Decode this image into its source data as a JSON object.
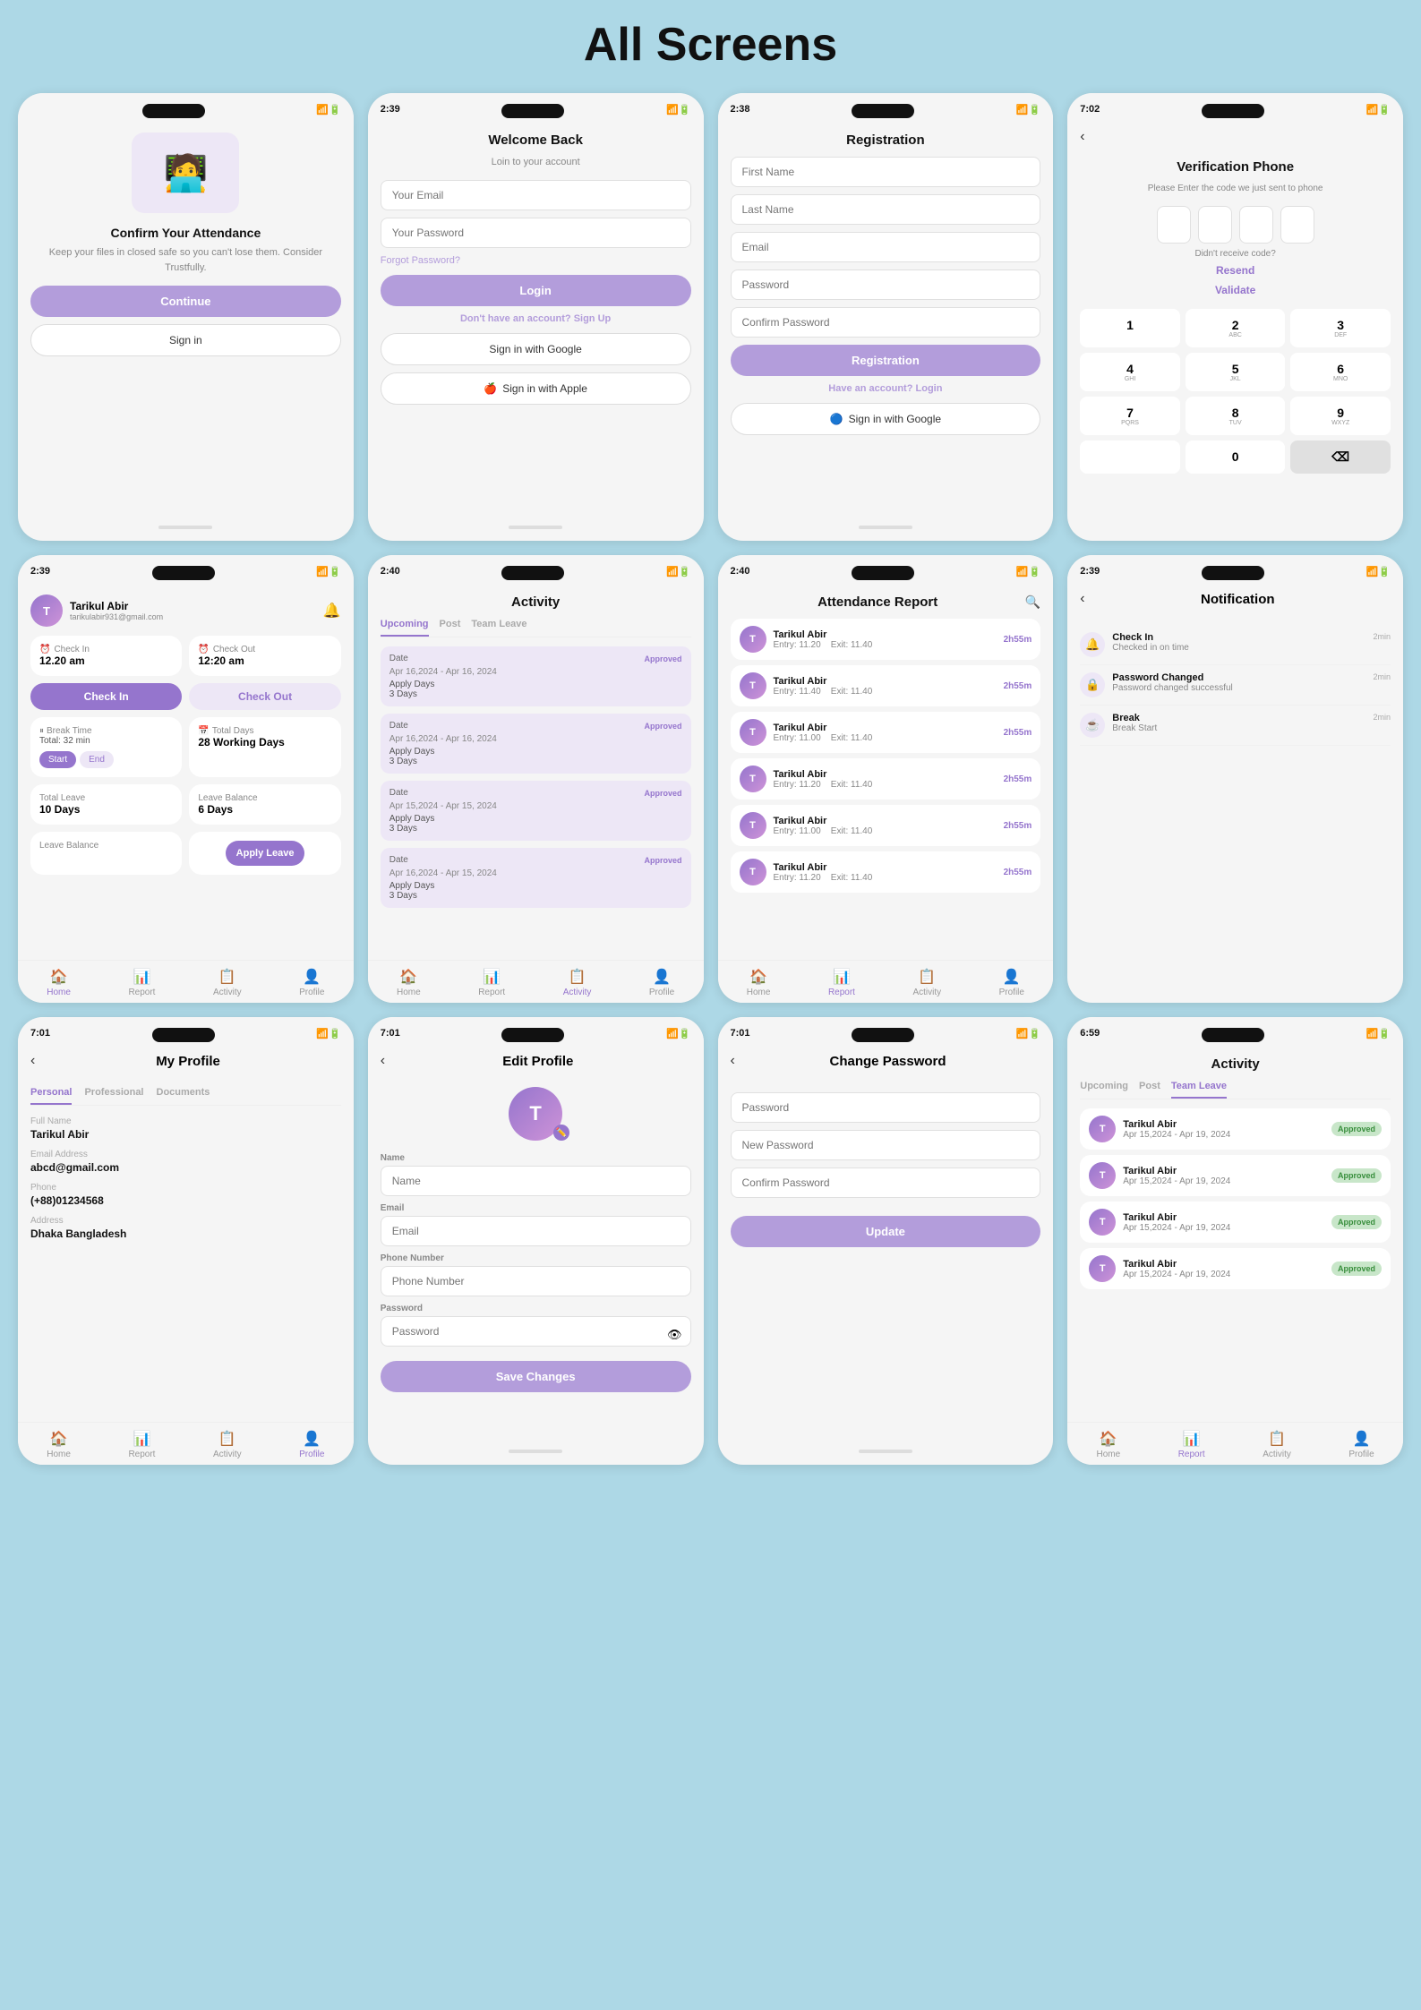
{
  "page": {
    "title": "All Screens"
  },
  "screens": [
    {
      "id": "welcome",
      "title": "",
      "type": "welcome"
    },
    {
      "id": "login",
      "title": "Login",
      "type": "login"
    },
    {
      "id": "registration",
      "title": "Registration",
      "type": "registration"
    },
    {
      "id": "verification",
      "title": "Verification Phone",
      "type": "verification"
    },
    {
      "id": "home",
      "title": "",
      "type": "home"
    },
    {
      "id": "activity",
      "title": "Activity",
      "type": "activity"
    },
    {
      "id": "attendance",
      "title": "Attendance Report",
      "type": "attendance"
    },
    {
      "id": "notification",
      "title": "Notification",
      "type": "notification"
    },
    {
      "id": "my-profile",
      "title": "My Profile",
      "type": "my-profile"
    },
    {
      "id": "edit-profile",
      "title": "Edit Profile",
      "type": "edit-profile"
    },
    {
      "id": "change-password",
      "title": "Change Password",
      "type": "change-password"
    },
    {
      "id": "team-leave",
      "title": "Activity",
      "type": "team-leave"
    }
  ],
  "login": {
    "time": "2:39",
    "welcome_title": "Welcome Back",
    "welcome_sub": "Loin to your account",
    "email_placeholder": "Your Email",
    "password_placeholder": "Your Password",
    "forgot": "Forgot Password?",
    "login_btn": "Login",
    "no_account": "Don't have an account?",
    "signup": "Sign Up",
    "google_btn": "Sign in with Google",
    "apple_btn": "Sign in with Apple"
  },
  "registration": {
    "time": "2:38",
    "title": "Registration",
    "fields": [
      "First Name",
      "Last Name",
      "Email",
      "Password",
      "Confirm Password"
    ],
    "reg_btn": "Registration",
    "have_account": "Have an account?",
    "login_link": "Login",
    "google_btn": "Sign in with Google"
  },
  "verification": {
    "time": "7:02",
    "title": "Verification Phone",
    "desc": "Please Enter the code we just sent to phone",
    "resend": "Resend",
    "validate": "Validate",
    "keys": [
      "1",
      "2",
      "3",
      "4",
      "5",
      "6",
      "7",
      "8",
      "9",
      "0"
    ],
    "key_subs": [
      "",
      "ABC",
      "DEF",
      "GHI",
      "JKL",
      "MNO",
      "PQRS",
      "TUV",
      "WXYZ",
      ""
    ]
  },
  "welcome": {
    "title": "Confirm Your Attendance",
    "desc": "Keep your files in closed safe so you can't lose them. Consider Trustfully.",
    "continue_btn": "Continue",
    "signin_btn": "Sign in"
  },
  "home": {
    "time": "2:39",
    "user_name": "Tarikul Abir",
    "user_email": "tarikulabir931@gmail.com",
    "check_in_time": "12.20 am",
    "check_out_time": "12:20 am",
    "check_in_label": "Check In",
    "check_out_label": "Check Out",
    "break_time": "Break Time",
    "break_total": "Total: 32 min",
    "check_in_btn": "Check In",
    "check_out_btn": "Check Out",
    "total_days_label": "Total Days",
    "total_days_val": "28 Working Days",
    "break_start": "Start",
    "break_end": "End",
    "total_leave": "Total Leave",
    "total_leave_val": "10 Days",
    "leave_balance": "Leave Balance",
    "leave_balance_val": "6 Days",
    "leave_balance2": "Leave Balance",
    "apply_leave": "Apply Leave",
    "nav": [
      "Home",
      "Report",
      "Activity",
      "Profile"
    ]
  },
  "attendance": {
    "time": "2:40",
    "title": "Attendance Report",
    "rows": [
      {
        "name": "Tarikul Abir",
        "entry": "Entry: 11.20",
        "exit": "Exit: 11.40",
        "dur": "2h55m"
      },
      {
        "name": "Tarikul Abir",
        "entry": "Entry: 11.40",
        "exit": "Exit: 11.40",
        "dur": "2h55m"
      },
      {
        "name": "Tarikul Abir",
        "entry": "Entry: 11.00",
        "exit": "Exit: 11.40",
        "dur": "2h55m"
      },
      {
        "name": "Tarikul Abir",
        "entry": "Entry: 11.20",
        "exit": "Exit: 11.40",
        "dur": "2h55m"
      },
      {
        "name": "Tarikul Abir",
        "entry": "Entry: 11.00",
        "exit": "Exit: 11.40",
        "dur": "2h55m"
      },
      {
        "name": "Tarikul Abir",
        "entry": "Entry: 11.20",
        "exit": "Exit: 11.40",
        "dur": "2h55m"
      }
    ],
    "nav": [
      "Home",
      "Report",
      "Activity",
      "Profile"
    ]
  },
  "activity": {
    "time": "2:40",
    "title": "Activity",
    "tabs": [
      "Upcoming",
      "Post",
      "Team Leave"
    ],
    "active_tab": "Upcoming",
    "cards": [
      {
        "date": "Apr 16,2024 - Apr 16, 2024",
        "status": "Approved",
        "apply_days": "Apply Days",
        "days": "3 Days"
      },
      {
        "date": "Apr 16,2024 - Apr 16, 2024",
        "status": "Approved",
        "apply_days": "Apply Days",
        "days": "3 Days"
      },
      {
        "date": "Apr 15,2024 - Apr 15, 2024",
        "status": "Approved",
        "apply_days": "Apply Days",
        "days": "3 Days"
      },
      {
        "date": "Apr 16,2024 - Apr 15, 2024",
        "status": "Approved",
        "apply_days": "Apply Days",
        "days": "3 Days"
      }
    ],
    "nav": [
      "Home",
      "Report",
      "Activity",
      "Profile"
    ]
  },
  "notification": {
    "time": "2:39",
    "title": "Notification",
    "items": [
      {
        "icon": "🔔",
        "title": "Check In",
        "desc": "Checked in on time",
        "time": "2min"
      },
      {
        "icon": "🔒",
        "title": "Password Changed",
        "desc": "Password changed successful",
        "time": "2min"
      },
      {
        "icon": "☕",
        "title": "Break",
        "desc": "Break Start",
        "time": "2min"
      }
    ]
  },
  "my_profile": {
    "time": "7:01",
    "title": "My Profile",
    "tabs": [
      "Personal",
      "Professional",
      "Documents"
    ],
    "full_name_label": "Full Name",
    "full_name": "Tarikul Abir",
    "email_label": "Email Address",
    "email": "abcd@gmail.com",
    "phone_label": "Phone",
    "phone": "(+88)01234568",
    "address_label": "Address",
    "address": "Dhaka Bangladesh"
  },
  "edit_profile": {
    "time": "7:01",
    "title": "Edit Profile",
    "name_label": "Name",
    "name_placeholder": "Name",
    "email_label": "Email",
    "email_placeholder": "Email",
    "phone_label": "Phone Number",
    "phone_placeholder": "Phone Number",
    "password_label": "Password",
    "password_placeholder": "Password",
    "save_btn": "Save Changes"
  },
  "change_password": {
    "time": "7:01",
    "title": "Change Password",
    "fields": [
      "Password",
      "New Password",
      "Confirm Password"
    ],
    "update_btn": "Update"
  },
  "team_leave": {
    "time": "6:59",
    "title": "Activity",
    "tabs": [
      "Upcoming",
      "Post",
      "Team Leave"
    ],
    "active_tab": "Team Leave",
    "rows": [
      {
        "name": "Tarikul Abir",
        "date": "Apr 15,2024 - Apr 19, 2024",
        "status": "Approved"
      },
      {
        "name": "Tarikul Abir",
        "date": "Apr 15,2024 - Apr 19, 2024",
        "status": "Approved"
      },
      {
        "name": "Tarikul Abir",
        "date": "Apr 15,2024 - Apr 19, 2024",
        "status": "Approved"
      },
      {
        "name": "Tarikul Abir",
        "date": "Apr 15,2024 - Apr 19, 2024",
        "status": "Approved"
      }
    ],
    "nav": [
      "Home",
      "Report",
      "Activity",
      "Profile"
    ]
  }
}
